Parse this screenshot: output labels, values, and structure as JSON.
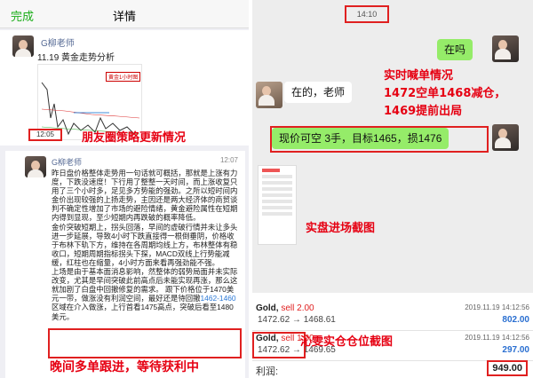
{
  "left": {
    "nav": {
      "back_label": "完成",
      "title": "详情"
    },
    "post1": {
      "author": "G柳老师",
      "text": "11.19 黄金走势分析",
      "chart_label": "黄金1小时图",
      "time": "12:05"
    },
    "caption_moments": "朋友圈策略更新情况",
    "post2": {
      "author": "G柳老师",
      "time": "12:07",
      "body_a": "昨日盘价格整体走势用一句话就可概括，那就是上涨有力度，下跌没速度！下行用了整整一天时间，而上涨收复只用了三个小时多，足见多方势能的强劲。之所以短时间内金价出现较强的上扬走势，主因还是两大经济体的商贸谈判不确定性增加了市场的避险情绪，黄金避险属性在短期内得到显现，至少短期内再跌破的概率降低。\n金价突破短期上，拐头回落，早间的虚破行情并未让多头进一步延展，导致4小时下跌直接得一根倒垂阴，价格收于布林下轨下方，维持在各周期均线上方，布林整体有稳收口，短期周期指标拐头下探，MACD双线上行势能减缓，红柱也在缩量，4小时方面来看再强劲能不强。\n上场是由于基本面消息影响，然整体的弱势局面并未实际改变，尤其是早间突破此前高点后未能实现再涨，那么这就加剧了白盘中回撤修复的需求。 跟下价格位于1470美元一带，做涨没有利润空间，最好还是待回撤",
      "link_range": "1462-1460",
      "body_b": "区域在介入做涨，上行首看1475高点，突破后看至1480美元。"
    },
    "caption_follow": "晚间多单跟进，等待获利中"
  },
  "right": {
    "time": "14:10",
    "msg_user": "在吗",
    "msg_teacher": "在的，老师",
    "msg_trade": "现价可空 3手，目标1465，损1476",
    "caption_realtime_1": "实时喊单情况",
    "caption_realtime_2": "1472空单1468减仓，",
    "caption_realtime_3": "1469提前出局",
    "caption_entry": "实盘进场截图",
    "caption_position": "沁雯实仓仓位截图",
    "positions": [
      {
        "symbol": "Gold,",
        "side": "sell 2.00",
        "date": "2019.11.19 14:12:56",
        "prices": "1472.62 → 1468.61",
        "profit": "802.00"
      },
      {
        "symbol": "Gold,",
        "side": "sell 1.00",
        "date": "2019.11.19 14:12:56",
        "prices": "1472.62 → 1469.65",
        "profit": "297.00"
      }
    ],
    "profit_label": "利润:",
    "profit_total": "949.00"
  }
}
